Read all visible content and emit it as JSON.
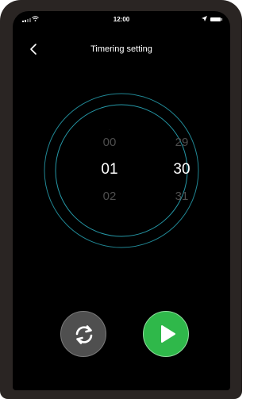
{
  "status_bar": {
    "time": "12:00"
  },
  "header": {
    "title": "Timering setting"
  },
  "picker": {
    "hours": {
      "prev": "00",
      "selected": "01",
      "next": "02"
    },
    "minutes": {
      "prev": "29",
      "selected": "30",
      "next": "31"
    }
  },
  "icons": {
    "back": "chevron-left-icon",
    "reset": "refresh-icon",
    "play": "play-icon"
  },
  "colors": {
    "ring": "#2bb3c4",
    "play": "#2fb84a",
    "reset": "#4f4f4f"
  }
}
